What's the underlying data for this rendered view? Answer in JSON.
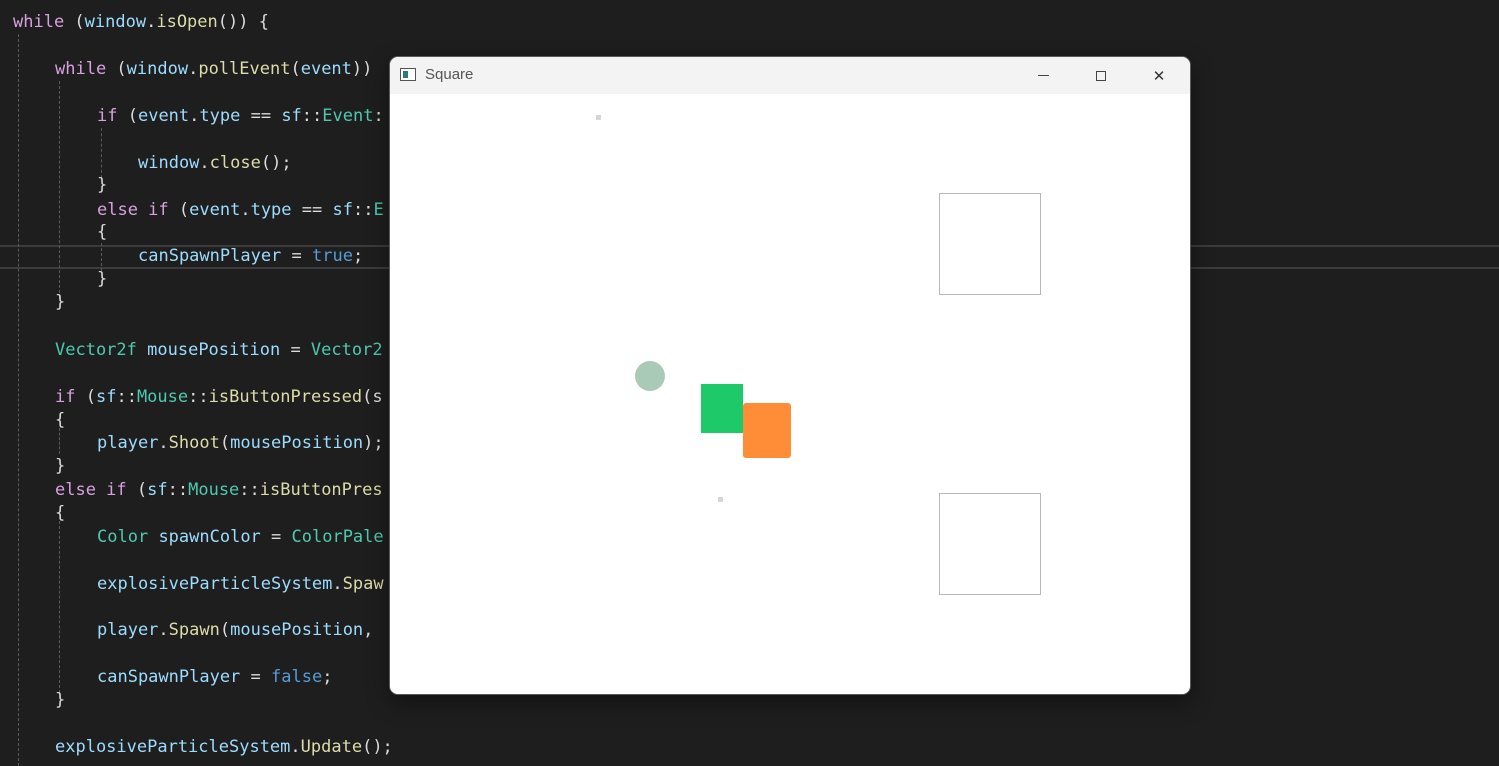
{
  "editor": {
    "lines": [
      [
        [
          "kw",
          "while"
        ],
        [
          "pu",
          " ("
        ],
        [
          "id",
          "window"
        ],
        [
          "pu",
          "."
        ],
        [
          "fn",
          "isOpen"
        ],
        [
          "pu",
          "()) {"
        ]
      ],
      [
        [
          "kw",
          "while"
        ],
        [
          "pu",
          " ("
        ],
        [
          "id",
          "window"
        ],
        [
          "pu",
          "."
        ],
        [
          "fn",
          "pollEvent"
        ],
        [
          "pu",
          "("
        ],
        [
          "id",
          "event"
        ],
        [
          "pu",
          "))"
        ]
      ],
      [
        [
          "kw",
          "if"
        ],
        [
          "pu",
          " ("
        ],
        [
          "id",
          "event"
        ],
        [
          "pu",
          "."
        ],
        [
          "id",
          "type"
        ],
        [
          "pu",
          " == "
        ],
        [
          "id",
          "sf"
        ],
        [
          "pu",
          "::"
        ],
        [
          "ty",
          "Event"
        ],
        [
          "pu",
          ":"
        ]
      ],
      [
        [
          "id",
          "window"
        ],
        [
          "pu",
          "."
        ],
        [
          "fn",
          "close"
        ],
        [
          "pu",
          "();"
        ]
      ],
      [
        [
          "pu",
          "}"
        ]
      ],
      [
        [
          "kw",
          "else if"
        ],
        [
          "pu",
          " ("
        ],
        [
          "id",
          "event"
        ],
        [
          "pu",
          "."
        ],
        [
          "id",
          "type"
        ],
        [
          "pu",
          " == "
        ],
        [
          "id",
          "sf"
        ],
        [
          "pu",
          "::"
        ],
        [
          "ty",
          "E"
        ]
      ],
      [
        [
          "pu",
          "{"
        ]
      ],
      [
        [
          "id",
          "canSpawnPlayer"
        ],
        [
          "pu",
          " = "
        ],
        [
          "bool",
          "true"
        ],
        [
          "pu",
          ";"
        ]
      ],
      [
        [
          "pu",
          "}"
        ]
      ],
      [
        [
          "pu",
          "}"
        ]
      ],
      [
        [
          "ty",
          "Vector2f"
        ],
        [
          "pu",
          " "
        ],
        [
          "id",
          "mousePosition"
        ],
        [
          "pu",
          " = "
        ],
        [
          "ty",
          "Vector2"
        ]
      ],
      [
        [
          "kw",
          "if"
        ],
        [
          "pu",
          " ("
        ],
        [
          "id",
          "sf"
        ],
        [
          "pu",
          "::"
        ],
        [
          "ty",
          "Mouse"
        ],
        [
          "pu",
          "::"
        ],
        [
          "fn",
          "isButtonPressed"
        ],
        [
          "pu",
          "(s"
        ]
      ],
      [
        [
          "pu",
          "{"
        ]
      ],
      [
        [
          "id",
          "player"
        ],
        [
          "pu",
          "."
        ],
        [
          "fn",
          "Shoot"
        ],
        [
          "pu",
          "("
        ],
        [
          "id",
          "mousePosition"
        ],
        [
          "pu",
          ");"
        ]
      ],
      [
        [
          "pu",
          "}"
        ]
      ],
      [
        [
          "kw",
          "else if"
        ],
        [
          "pu",
          " ("
        ],
        [
          "id",
          "sf"
        ],
        [
          "pu",
          "::"
        ],
        [
          "ty",
          "Mouse"
        ],
        [
          "pu",
          "::"
        ],
        [
          "fn",
          "isButtonPres"
        ]
      ],
      [
        [
          "pu",
          "{"
        ]
      ],
      [
        [
          "ty",
          "Color"
        ],
        [
          "pu",
          " "
        ],
        [
          "id",
          "spawnColor"
        ],
        [
          "pu",
          " = "
        ],
        [
          "ty",
          "ColorPale"
        ]
      ],
      [
        [
          "id",
          "explosiveParticleSystem"
        ],
        [
          "pu",
          "."
        ],
        [
          "fn",
          "Spaw"
        ]
      ],
      [
        [
          "id",
          "player"
        ],
        [
          "pu",
          "."
        ],
        [
          "fn",
          "Spawn"
        ],
        [
          "pu",
          "("
        ],
        [
          "id",
          "mousePosition"
        ],
        [
          "pu",
          ", "
        ]
      ],
      [
        [
          "id",
          "canSpawnPlayer"
        ],
        [
          "pu",
          " = "
        ],
        [
          "bool",
          "false"
        ],
        [
          "pu",
          ";"
        ]
      ],
      [
        [
          "pu",
          "}"
        ]
      ],
      [
        [
          "id",
          "explosiveParticleSystem"
        ],
        [
          "pu",
          "."
        ],
        [
          "fn",
          "Update"
        ],
        [
          "pu",
          "();"
        ]
      ]
    ]
  },
  "window": {
    "title": "Square",
    "minimize_symbol": "",
    "maximize_symbol": "",
    "close_symbol": "✕"
  },
  "scene": {
    "circle_color": "#aacab8",
    "player_color": "#1ec96a",
    "enemy_color": "#ff8c37"
  }
}
